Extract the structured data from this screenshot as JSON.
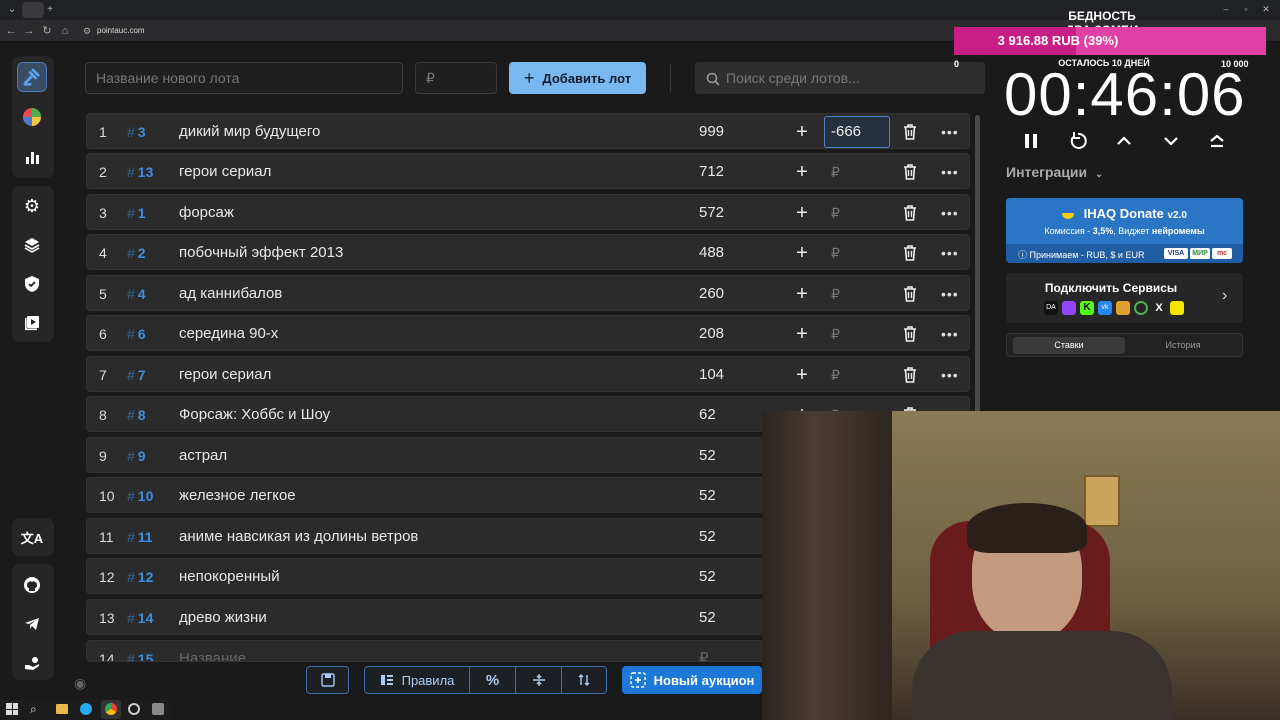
{
  "browser": {
    "url": "pointauc.com"
  },
  "top": {
    "new_lot_placeholder": "Название нового лота",
    "price_placeholder": "₽",
    "add_lot_label": "Добавить лот",
    "search_placeholder": "Поиск среди лотов..."
  },
  "lots": [
    {
      "num": "1",
      "id": "3",
      "name": "дикий мир будущего",
      "amount": "999",
      "edit_value": "-666"
    },
    {
      "num": "2",
      "id": "13",
      "name": "герои сериал",
      "amount": "712"
    },
    {
      "num": "3",
      "id": "1",
      "name": "форсаж",
      "amount": "572"
    },
    {
      "num": "4",
      "id": "2",
      "name": "побочный эффект 2013",
      "amount": "488"
    },
    {
      "num": "5",
      "id": "4",
      "name": "ад каннибалов",
      "amount": "260"
    },
    {
      "num": "6",
      "id": "6",
      "name": "середина 90-х",
      "amount": "208"
    },
    {
      "num": "7",
      "id": "7",
      "name": "герои сериал",
      "amount": "104"
    },
    {
      "num": "8",
      "id": "8",
      "name": "Форсаж: Хоббс и Шоу",
      "amount": "62"
    },
    {
      "num": "9",
      "id": "9",
      "name": "астрал",
      "amount": "52"
    },
    {
      "num": "10",
      "id": "10",
      "name": "железное легкое",
      "amount": "52"
    },
    {
      "num": "11",
      "id": "11",
      "name": "аниме навсикая из долины ветров",
      "amount": "52"
    },
    {
      "num": "12",
      "id": "12",
      "name": "непокоренный",
      "amount": "52"
    },
    {
      "num": "13",
      "id": "14",
      "name": "древо жизни",
      "amount": "52"
    },
    {
      "num": "14",
      "id": "15",
      "name": "Название",
      "amount": "₽"
    }
  ],
  "row_symbols": {
    "hash": "#",
    "rub": "₽"
  },
  "toolbar": {
    "rules_label": "Правила",
    "percent_label": "%",
    "new_auction_label": "Новый аукцион"
  },
  "goal": {
    "title": "БЕДНОСТЬ ДВА.ЗОМБИ",
    "amount_text": "3 916.88 RUB (39%)",
    "progress": 0.39,
    "remaining": "ОСТАЛОСЬ 10 ДНЕЙ",
    "min": "0",
    "max": "10 000"
  },
  "timer": {
    "value": "00:46:06"
  },
  "integrations": {
    "label": "Интеграции"
  },
  "donate": {
    "title": "IHAQ Donate",
    "version": "v2.0",
    "commission_prefix": "Комиссия - ",
    "commission_value": "3,5%",
    "widget_prefix": ", Виджет ",
    "widget_value": "нейромемы",
    "accepts": "Принимаем - RUB, $ и EUR",
    "cards": [
      "VISA",
      "МИР",
      "mc"
    ]
  },
  "services": {
    "title": "Подключить Сервисы"
  },
  "history_tabs": {
    "bets": "Ставки",
    "history": "История"
  },
  "colors": {
    "accent": "#3d8fe0",
    "primary_button": "#78b7f0",
    "goal_bar": "#e03fa6"
  }
}
